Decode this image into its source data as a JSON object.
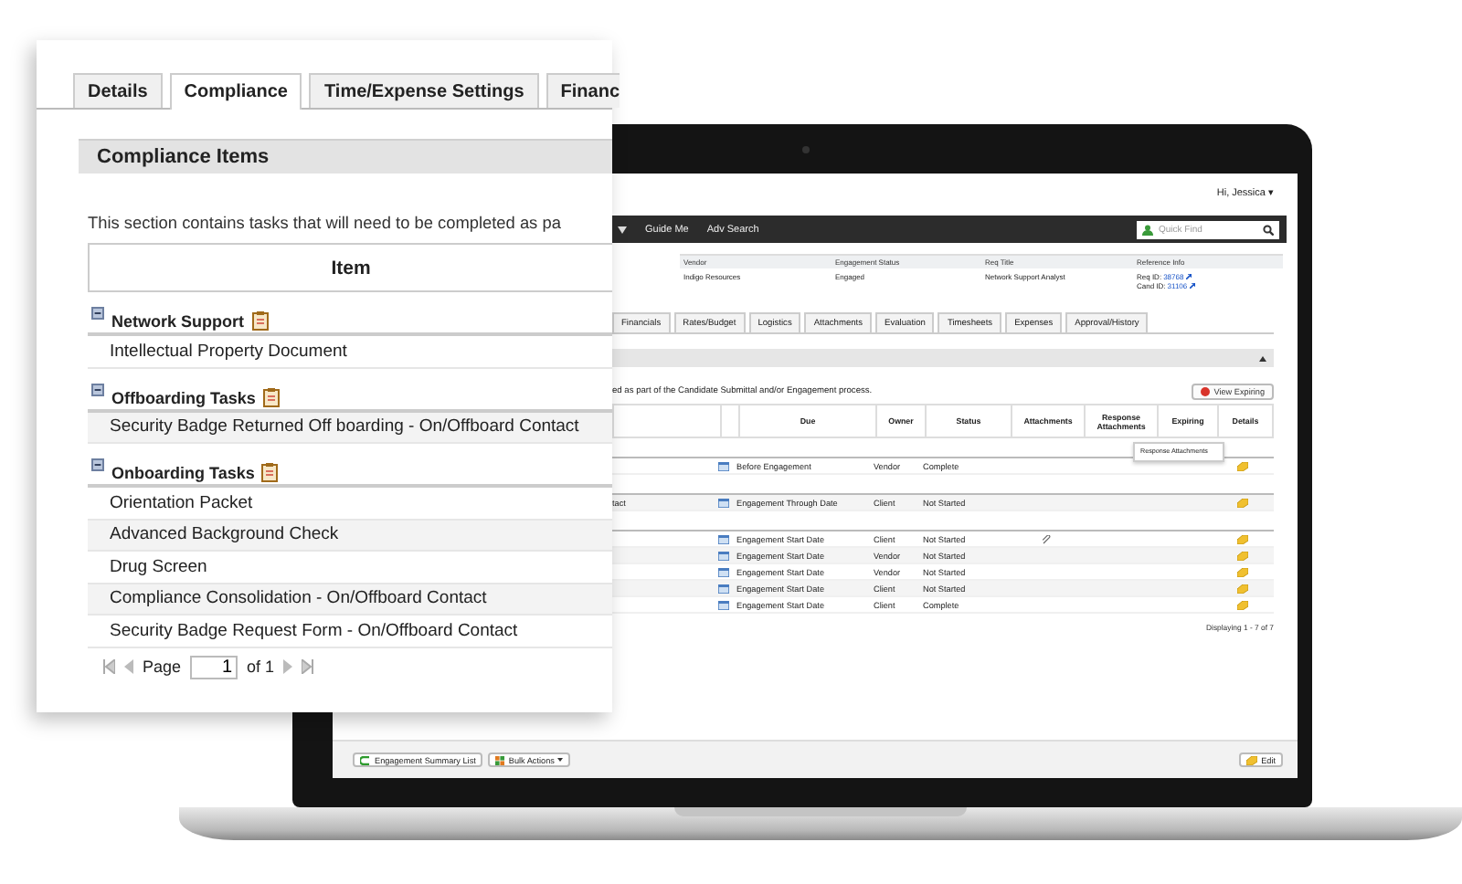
{
  "laptop_screen": {
    "greeting": "Hi, Jessica ▾",
    "nav": {
      "items": [
        "Guide Me",
        "Adv Search"
      ],
      "quick_find": {
        "placeholder": "Quick Find"
      }
    },
    "summary": [
      {
        "kind": "text",
        "label": "Vendor",
        "value": "Indigo Resources"
      },
      {
        "kind": "text",
        "label": "Engagement Status",
        "value": "Engaged"
      },
      {
        "kind": "text",
        "label": "Req Title",
        "value": "Network Support Analyst"
      },
      {
        "kind": "links",
        "label": "Reference Info",
        "links": [
          {
            "prefix": "Req ID:",
            "value": "38768"
          },
          {
            "prefix": "Cand ID:",
            "value": "31106"
          }
        ]
      }
    ],
    "tabs": [
      {
        "label": "Financials",
        "selected": false
      },
      {
        "label": "Rates/Budget",
        "selected": false
      },
      {
        "label": "Logistics",
        "selected": false
      },
      {
        "label": "Attachments",
        "selected": false
      },
      {
        "label": "Evaluation",
        "selected": false
      },
      {
        "label": "Timesheets",
        "selected": false
      },
      {
        "label": "Expenses",
        "selected": false
      },
      {
        "label": "Approval/History",
        "selected": false
      }
    ],
    "description": "ed as part of the Candidate Submittal and/or Engagement process.",
    "view_expiring": "View Expiring",
    "table": {
      "columns": [
        "Due",
        "Owner",
        "Status",
        "Attachments",
        "Response Attachments",
        "Expiring",
        "Details"
      ],
      "groups": [
        {
          "rows": [
            {
              "item": "",
              "due": "Before Engagement",
              "owner": "Vendor",
              "status": "Complete",
              "attachment": false
            }
          ]
        },
        {
          "rows": [
            {
              "item": "tact",
              "due": "Engagement Through Date",
              "owner": "Client",
              "status": "Not Started",
              "attachment": false
            }
          ]
        },
        {
          "rows": [
            {
              "item": "",
              "due": "Engagement Start Date",
              "owner": "Client",
              "status": "Not Started",
              "attachment": true
            },
            {
              "item": "",
              "due": "Engagement Start Date",
              "owner": "Vendor",
              "status": "Not Started",
              "attachment": false
            },
            {
              "item": "",
              "due": "Engagement Start Date",
              "owner": "Vendor",
              "status": "Not Started",
              "attachment": false
            },
            {
              "item": "",
              "due": "Engagement Start Date",
              "owner": "Client",
              "status": "Not Started",
              "attachment": false
            },
            {
              "item": "",
              "due": "Engagement Start Date",
              "owner": "Client",
              "status": "Complete",
              "attachment": false
            }
          ]
        }
      ]
    },
    "tooltip": "Response Attachments",
    "displaying": "Displaying 1 - 7 of 7",
    "toolbar": [
      {
        "kind": "back",
        "label": "Engagement Summary List"
      },
      {
        "kind": "menu",
        "label": "Bulk Actions"
      },
      {
        "kind": "edit",
        "label": "Edit"
      }
    ]
  },
  "zoom_panel": {
    "tabs": [
      {
        "label": "Details",
        "selected": false
      },
      {
        "label": "Compliance",
        "selected": true
      },
      {
        "label": "Time/Expense Settings",
        "selected": false
      },
      {
        "label": "Financ",
        "selected": false
      }
    ],
    "section_title": "Compliance Items",
    "description": "This section contains tasks that will need to be completed as pa",
    "column": "Item",
    "groups": [
      {
        "name": "Network Support",
        "expanded": true,
        "items": [
          "Intellectual Property Document"
        ]
      },
      {
        "name": "Offboarding Tasks",
        "expanded": true,
        "items": [
          "Security Badge Returned Off boarding - On/Offboard Contact"
        ]
      },
      {
        "name": "Onboarding Tasks",
        "expanded": true,
        "items": [
          "Orientation Packet",
          "Advanced Background Check",
          "Drug Screen",
          "Compliance Consolidation - On/Offboard Contact",
          "Security Badge Request Form - On/Offboard Contact"
        ]
      }
    ],
    "pager": {
      "label": "Page",
      "value": "1",
      "of": "of 1"
    }
  }
}
